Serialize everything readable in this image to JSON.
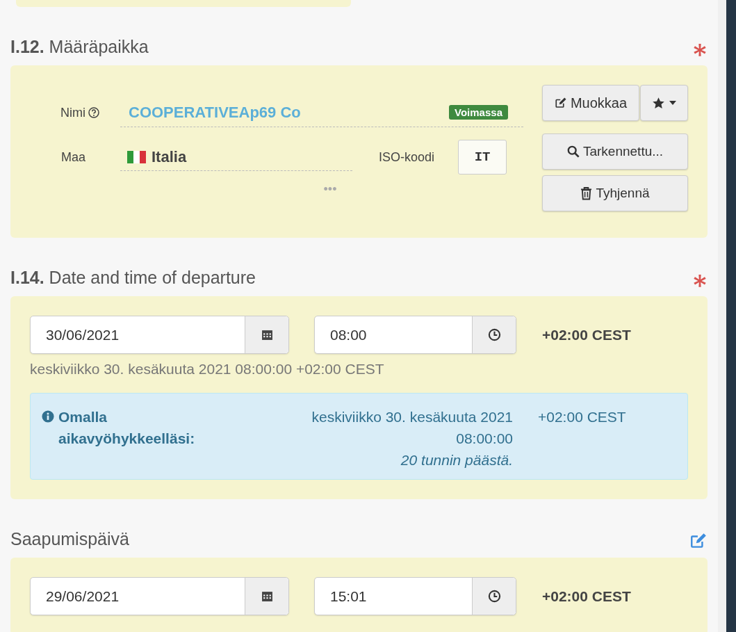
{
  "sections": [
    {
      "kind": "party",
      "number": "I.12.",
      "title": "Määräpaikka",
      "required": true,
      "editable": false,
      "name_label": "Nimi",
      "name_value": "COOPERATIVEAp69 Co",
      "status_badge": "Voimassa",
      "country_label": "Maa",
      "country_value": "Italia",
      "iso_label": "ISO-koodi",
      "iso_value": "IT",
      "more": "•••",
      "buttons": [
        {
          "kind": "edit",
          "label": "Muokkaa"
        },
        {
          "kind": "search",
          "label": "Tarkennettu..."
        },
        {
          "kind": "clear",
          "label": "Tyhjennä"
        }
      ]
    },
    {
      "kind": "datetime",
      "number": "I.14.",
      "title": "Date and time of departure",
      "required": true,
      "editable": false,
      "date": "30/06/2021",
      "time": "08:00",
      "timezone": "+02:00 CEST",
      "summary": "keskiviikko 30. kesäkuuta 2021 08:00:00 +02:00 CEST",
      "info": {
        "label": "Omalla aikavyöhykkeelläsi:",
        "date_line": "keskiviikko 30. kesäkuuta 2021",
        "time_line": "08:00:00",
        "relative": "20 tunnin päästä.",
        "timezone": "+02:00 CEST"
      }
    },
    {
      "kind": "datetime",
      "title": "Saapumispäivä",
      "required": false,
      "editable": true,
      "date": "29/06/2021",
      "time": "15:01",
      "timezone": "+02:00 CEST"
    }
  ]
}
